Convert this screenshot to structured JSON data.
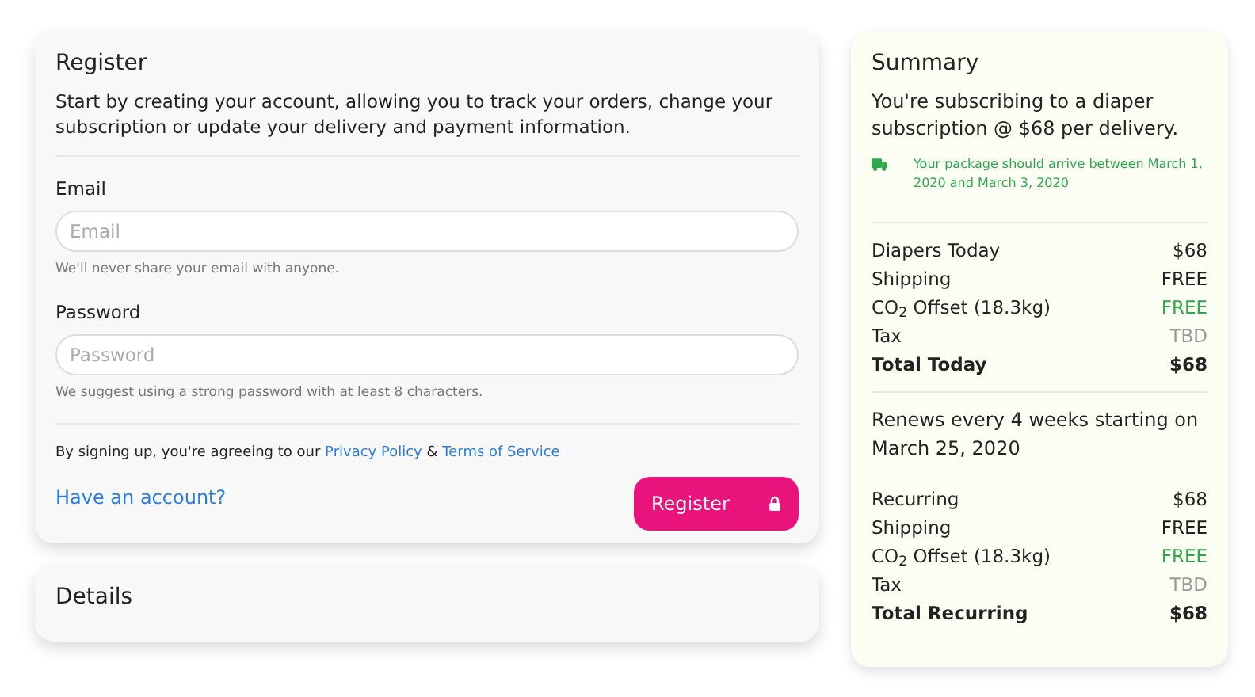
{
  "register": {
    "title": "Register",
    "intro": "Start by creating your account, allowing you to track your orders, change your subscription or update your delivery and payment information.",
    "fields": [
      {
        "label": "Email",
        "placeholder": "Email",
        "help": "We'll never share your email with anyone."
      },
      {
        "label": "Password",
        "placeholder": "Password",
        "help": "We suggest using a strong password with at least 8 characters."
      }
    ],
    "terms": {
      "text": "By signing up, you're agreeing to our",
      "link1": "Privacy Policy",
      "joiner": "&",
      "link2": "Terms of Service"
    },
    "account_link": "Have an account?",
    "submit": "Register"
  },
  "details": {
    "title": "Details"
  },
  "summary": {
    "title": "Summary",
    "intro": "You're subscribing to a diaper subscription @ $68 per delivery.",
    "delivery_note": "Your package should arrive between March 1, 2020 and March 3, 2020",
    "today": [
      {
        "label": "Diapers Today",
        "value": "$68",
        "kind": "plain"
      },
      {
        "label": "Shipping",
        "value": "FREE",
        "kind": "plain"
      },
      {
        "label": "CO$_{2}$ Offset (18.3kg)",
        "value": "FREE",
        "kind": "free"
      },
      {
        "label": "Tax",
        "value": "TBD",
        "kind": "muted"
      },
      {
        "label": "Total Today",
        "value": "$68",
        "kind": "total"
      }
    ],
    "renewal": "Renews every 4 weeks starting on March 25, 2020",
    "recurring": [
      {
        "label": "Recurring",
        "value": "$68",
        "kind": "plain"
      },
      {
        "label": "Shipping",
        "value": "FREE",
        "kind": "plain"
      },
      {
        "label": "CO$_{2}$ Offset (18.3kg)",
        "value": "FREE",
        "kind": "free"
      },
      {
        "label": "Tax",
        "value": "TBD",
        "kind": "muted"
      },
      {
        "label": "Total Recurring",
        "value": "$68",
        "kind": "total"
      }
    ]
  }
}
